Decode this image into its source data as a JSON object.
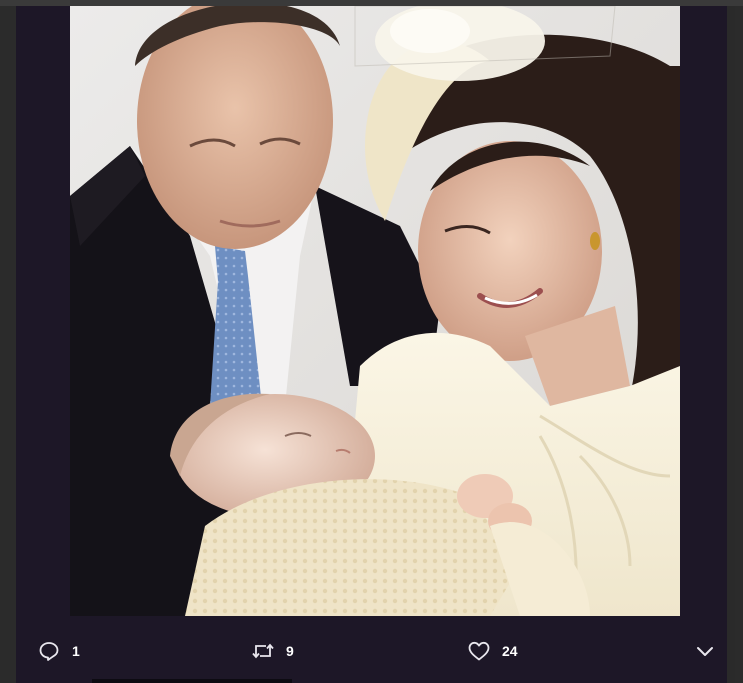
{
  "tweet": {
    "media": {
      "image_description_icon": "photo"
    },
    "actions": {
      "reply": {
        "icon": "reply-icon",
        "count": "1"
      },
      "retweet": {
        "icon": "retweet-icon",
        "count": "9"
      },
      "like": {
        "icon": "heart-icon",
        "count": "24"
      },
      "more": {
        "icon": "chevron-down-icon"
      }
    }
  },
  "colors": {
    "card_background": "#1d1727",
    "icon_color": "#e9e7ee"
  }
}
